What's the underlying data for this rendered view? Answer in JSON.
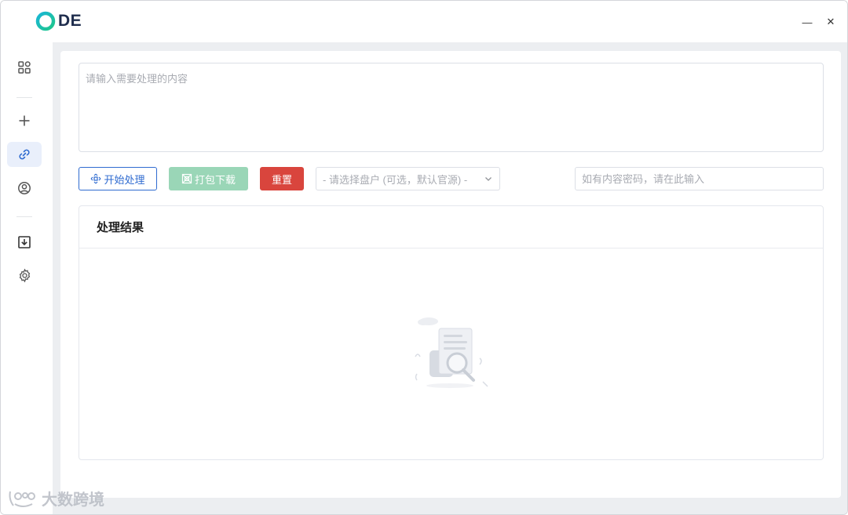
{
  "app": {
    "logo_text": "DE",
    "brand_color": "#1f2d4d",
    "logo_ring_colors": [
      "#19b6d6",
      "#1fc78a"
    ]
  },
  "window_controls": {
    "minimize_label": "—",
    "close_label": "✕"
  },
  "sidebar": {
    "items": [
      {
        "name": "dashboard",
        "icon": "grid-icon"
      },
      {
        "name": "add",
        "icon": "plus-icon"
      },
      {
        "name": "link",
        "icon": "link-icon",
        "active": true
      },
      {
        "name": "user",
        "icon": "user-circle-icon"
      },
      {
        "name": "download",
        "icon": "download-box-icon"
      },
      {
        "name": "settings",
        "icon": "gear-icon"
      }
    ]
  },
  "input": {
    "placeholder": "请输入需要处理的内容",
    "value": ""
  },
  "toolbar": {
    "start_label": "开始处理",
    "pack_label": "打包下载",
    "reset_label": "重置",
    "start_color": "#2f6bd0",
    "pack_color": "#9ad6b7",
    "reset_color": "#d9453d"
  },
  "disk_select": {
    "placeholder": "- 请选择盘户 (可选，默认官源) -"
  },
  "password": {
    "placeholder": "如有内容密码，请在此输入",
    "value": ""
  },
  "result": {
    "title": "处理结果",
    "empty_icon": "empty-search-document-icon"
  },
  "watermark": {
    "text": "大数跨境"
  }
}
